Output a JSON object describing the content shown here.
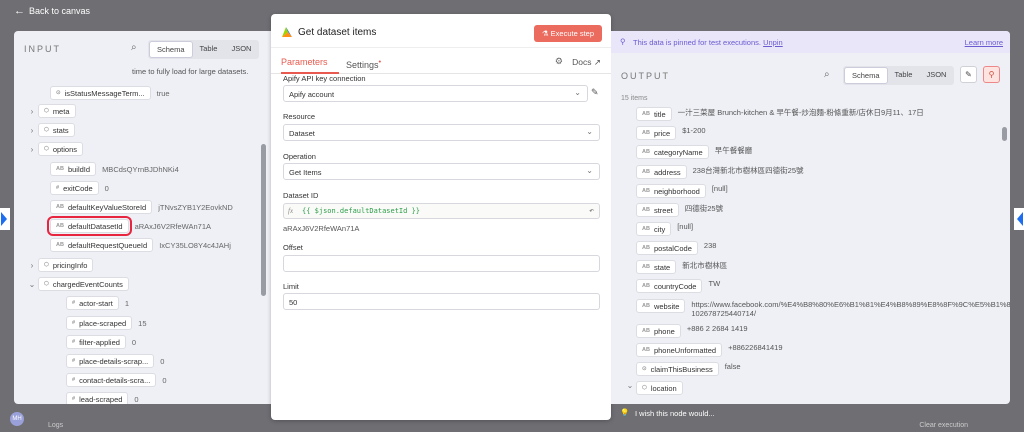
{
  "nav": {
    "back_label": "Back to canvas"
  },
  "input": {
    "title": "INPUT",
    "tabs": [
      "Schema",
      "Table",
      "JSON"
    ],
    "wrap_text": "time to fully load for large datasets.",
    "rows": [
      {
        "key": "isStatusMessageTerm...",
        "type": "icon",
        "value": "true"
      },
      {
        "key": "meta",
        "type": "obj",
        "value": ""
      },
      {
        "key": "stats",
        "type": "obj",
        "value": ""
      },
      {
        "key": "options",
        "type": "obj",
        "value": ""
      },
      {
        "key": "buildId",
        "type": "AB",
        "value": "MBCdsQYrnBJDhNKi4"
      },
      {
        "key": "exitCode",
        "type": "#",
        "value": "0"
      },
      {
        "key": "defaultKeyValueStoreId",
        "type": "AB",
        "value": "jTNvsZYB1Y2EovkND"
      },
      {
        "key": "defaultDatasetId",
        "type": "AB",
        "value": "aRAxJ6V2RfeWAn71A"
      },
      {
        "key": "defaultRequestQueueId",
        "type": "AB",
        "value": "IxCY35LO8Y4c4JAHj"
      },
      {
        "key": "pricingInfo",
        "type": "obj",
        "value": ""
      },
      {
        "key": "chargedEventCounts",
        "type": "obj",
        "value": ""
      },
      {
        "key": "actor-start",
        "type": "#",
        "value": "1"
      },
      {
        "key": "place-scraped",
        "type": "#",
        "value": "15"
      },
      {
        "key": "filter-applied",
        "type": "#",
        "value": "0"
      },
      {
        "key": "place-details-scrap...",
        "type": "#",
        "value": "0"
      },
      {
        "key": "contact-details-scra...",
        "type": "#",
        "value": "0"
      },
      {
        "key": "lead-scraped",
        "type": "#",
        "value": "0"
      }
    ]
  },
  "node": {
    "title": "Get dataset items",
    "execute_label": "Execute step",
    "tabs": {
      "parameters": "Parameters",
      "settings": "Settings",
      "docs": "Docs"
    },
    "fields": {
      "conn_label": "Apify API key connection",
      "conn_value": "Apify account",
      "resource_label": "Resource",
      "resource_value": "Dataset",
      "operation_label": "Operation",
      "operation_value": "Get Items",
      "dataset_label": "Dataset ID",
      "dataset_expr": "{{ $json.defaultDatasetId }}",
      "dataset_preview": "aRAxJ6V2RfeWAn71A",
      "offset_label": "Offset",
      "offset_value": "",
      "limit_label": "Limit",
      "limit_value": "50"
    }
  },
  "output": {
    "pinned_msg": "This data is pinned for test executions.",
    "unpin": "Unpin",
    "learn_more": "Learn more",
    "title": "OUTPUT",
    "tabs": [
      "Schema",
      "Table",
      "JSON"
    ],
    "count": "15 items",
    "rows": [
      {
        "key": "title",
        "type": "AB",
        "value": "一汁三菜屋 Brunch-kitchen & 早午餐-炒泡麵-粉條重新/店休日9月11、17日"
      },
      {
        "key": "price",
        "type": "AB",
        "value": "$1-200"
      },
      {
        "key": "categoryName",
        "type": "AB",
        "value": "早午餐餐廳"
      },
      {
        "key": "address",
        "type": "AB",
        "value": "238台灣新北市樹林區四德街25號"
      },
      {
        "key": "neighborhood",
        "type": "AB",
        "value": "[null]"
      },
      {
        "key": "street",
        "type": "AB",
        "value": "四德街25號"
      },
      {
        "key": "city",
        "type": "AB",
        "value": "[null]"
      },
      {
        "key": "postalCode",
        "type": "AB",
        "value": "238"
      },
      {
        "key": "state",
        "type": "AB",
        "value": "新北市樹林區"
      },
      {
        "key": "countryCode",
        "type": "AB",
        "value": "TW"
      },
      {
        "key": "website",
        "type": "AB",
        "value": "https://www.facebook.com/%E4%B8%80%E6%B1%81%E4%B8%89%E8%8F%9C%E5%B1%8B-102678725440714/"
      },
      {
        "key": "phone",
        "type": "AB",
        "value": "+886 2 2684 1419"
      },
      {
        "key": "phoneUnformatted",
        "type": "AB",
        "value": "+886226841419"
      },
      {
        "key": "claimThisBusiness",
        "type": "icon",
        "value": "false"
      },
      {
        "key": "location",
        "type": "obj",
        "value": ""
      }
    ]
  },
  "footer": {
    "note": "I wish this node would...",
    "logs": "Logs",
    "clear": "Clear execution"
  }
}
